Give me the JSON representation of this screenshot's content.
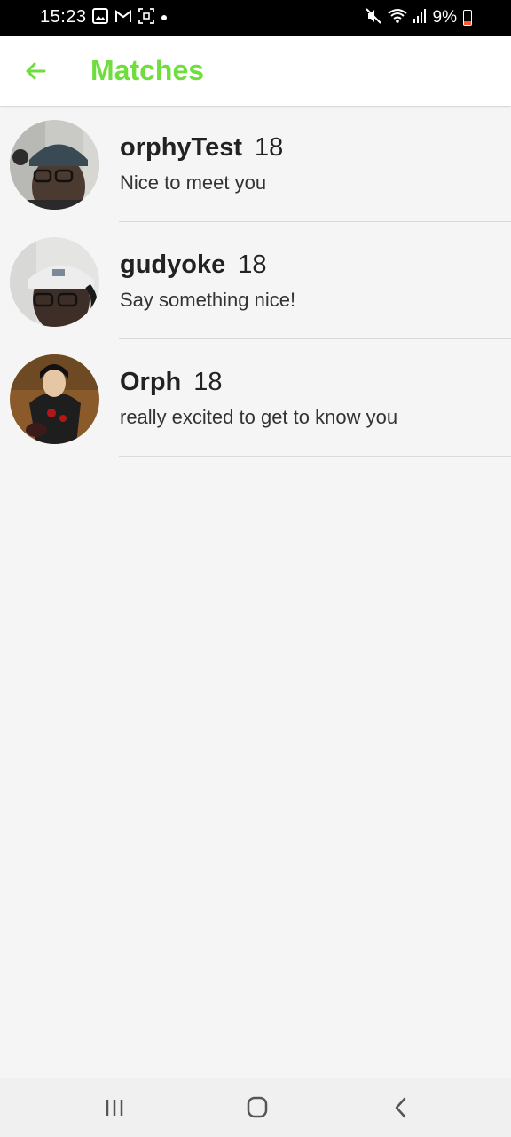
{
  "status_bar": {
    "time": "15:23",
    "battery_percent": "9%",
    "left_icons": [
      "gallery-icon",
      "gmail-icon",
      "screenshot-icon",
      "notification-dot-icon"
    ],
    "right_icons": [
      "mute-icon",
      "wifi-icon",
      "signal-icon",
      "battery-icon"
    ],
    "battery_color": "#ff5a36"
  },
  "app_bar": {
    "title": "Matches",
    "back_icon": "arrow-back-icon",
    "accent_color": "#6fdd3d"
  },
  "matches": [
    {
      "name": "orphyTest",
      "age": "18",
      "message": "Nice to meet you",
      "avatar": "avatar-photo-man-cap-glasses"
    },
    {
      "name": "gudyoke",
      "age": "18",
      "message": "Say something nice!",
      "avatar": "avatar-photo-man-cap-glasses-headphones"
    },
    {
      "name": "Orph",
      "age": "18",
      "message": "really excited to get to know you",
      "avatar": "avatar-anime-character-cloak"
    }
  ],
  "nav_bar": {
    "buttons": [
      "recents-icon",
      "home-icon",
      "back-icon"
    ]
  }
}
